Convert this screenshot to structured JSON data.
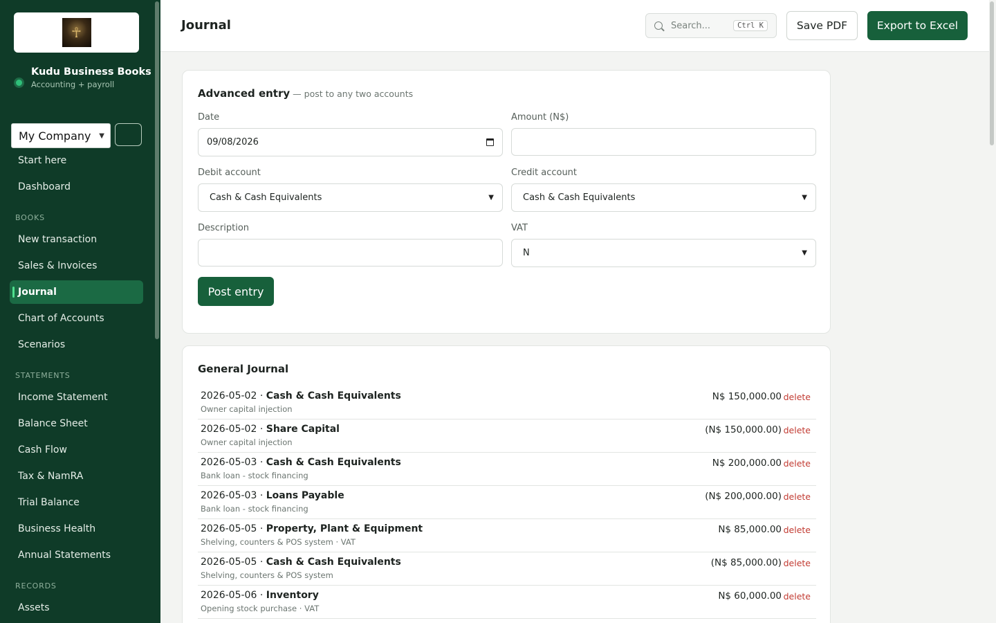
{
  "brand": {
    "logo_glyph": "☥",
    "name": "Kudu Business Books",
    "subtitle": "Accounting + payroll"
  },
  "company_select": {
    "value": "My Company"
  },
  "nav": {
    "top": [
      {
        "label": "Start here"
      },
      {
        "label": "Dashboard"
      }
    ],
    "sections": [
      {
        "title": "BOOKS",
        "items": [
          {
            "label": "New transaction"
          },
          {
            "label": "Sales & Invoices"
          },
          {
            "label": "Journal",
            "active": true
          },
          {
            "label": "Chart of Accounts"
          },
          {
            "label": "Scenarios"
          }
        ]
      },
      {
        "title": "STATEMENTS",
        "items": [
          {
            "label": "Income Statement"
          },
          {
            "label": "Balance Sheet"
          },
          {
            "label": "Cash Flow"
          },
          {
            "label": "Tax & NamRA"
          },
          {
            "label": "Trial Balance"
          },
          {
            "label": "Business Health"
          },
          {
            "label": "Annual Statements"
          }
        ]
      },
      {
        "title": "RECORDS",
        "items": [
          {
            "label": "Assets"
          }
        ]
      }
    ]
  },
  "topbar": {
    "title": "Journal",
    "search_placeholder": "Search...",
    "search_shortcut": "Ctrl K",
    "save_pdf": "Save PDF",
    "export_excel": "Export to Excel"
  },
  "entry_form": {
    "title": "Advanced entry",
    "subtitle": "— post to any two accounts",
    "date_label": "Date",
    "date_value": "09/08/2026",
    "amount_label": "Amount (N$)",
    "amount_value": "",
    "debit_label": "Debit account",
    "debit_value": "Cash & Cash Equivalents",
    "credit_label": "Credit account",
    "credit_value": "Cash & Cash Equivalents",
    "description_label": "Description",
    "description_value": "",
    "vat_label": "VAT",
    "vat_value": "N",
    "post_label": "Post entry"
  },
  "journal": {
    "title": "General Journal",
    "delete_label": "delete",
    "rows": [
      {
        "date": "2026-05-02",
        "account": "Cash & Cash Equivalents",
        "description": "Owner capital injection",
        "amount": "N$ 150,000.00"
      },
      {
        "date": "2026-05-02",
        "account": "Share Capital",
        "description": "Owner capital injection",
        "amount": "(N$ 150,000.00)"
      },
      {
        "date": "2026-05-03",
        "account": "Cash & Cash Equivalents",
        "description": "Bank loan - stock financing",
        "amount": "N$ 200,000.00"
      },
      {
        "date": "2026-05-03",
        "account": "Loans Payable",
        "description": "Bank loan - stock financing",
        "amount": "(N$ 200,000.00)"
      },
      {
        "date": "2026-05-05",
        "account": "Property, Plant & Equipment",
        "description": "Shelving, counters & POS system · VAT",
        "amount": "N$ 85,000.00"
      },
      {
        "date": "2026-05-05",
        "account": "Cash & Cash Equivalents",
        "description": "Shelving, counters & POS system",
        "amount": "(N$ 85,000.00)"
      },
      {
        "date": "2026-05-06",
        "account": "Inventory",
        "description": "Opening stock purchase · VAT",
        "amount": "N$ 60,000.00"
      }
    ]
  },
  "colors": {
    "sidebar_bg": "#0f3b28",
    "accent": "#17603b",
    "delete": "#c23b32"
  }
}
